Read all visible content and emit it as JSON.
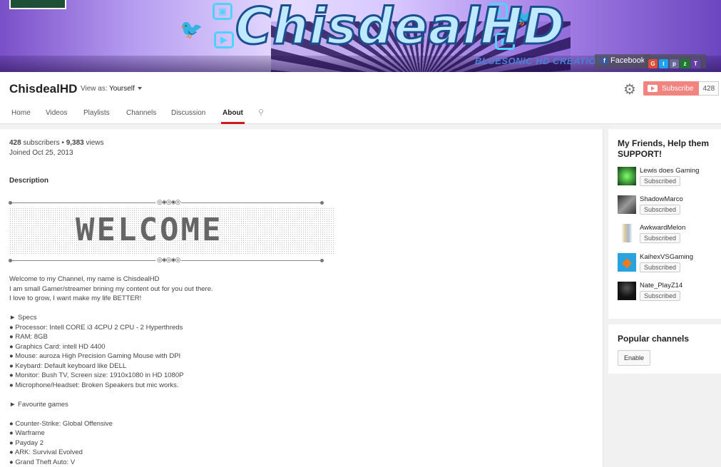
{
  "banner": {
    "title": "ChisdealHD",
    "credit": "BLUESONIC HD CREATIONS",
    "facebook_label": "Facebook",
    "social_icons": [
      "google-plus-icon",
      "twitter-icon",
      "periscope-icon",
      "green-icon",
      "twitch-icon"
    ]
  },
  "header": {
    "channel_name": "ChisdealHD",
    "view_as_label": "View as:",
    "view_as_value": "Yourself",
    "subscribe_label": "Subscribe",
    "subscriber_count": "428"
  },
  "tabs": [
    {
      "label": "Home"
    },
    {
      "label": "Videos"
    },
    {
      "label": "Playlists"
    },
    {
      "label": "Channels"
    },
    {
      "label": "Discussion"
    },
    {
      "label": "About",
      "active": true
    }
  ],
  "about": {
    "subscribers": "428",
    "subscribers_label": "subscribers",
    "separator": "•",
    "views": "9,383",
    "views_label": "views",
    "joined": "Joined Oct 25, 2013",
    "description_title": "Description",
    "welcome_art": "WELCOME",
    "lines": [
      "Welcome to my Channel, my name is ChisdealHD",
      "I am small Gamer/streamer brining my content out for you out there.",
      "I love to grow, I want make my life BETTER!",
      "",
      "► Specs",
      "● Processor: Intell CORE i3 4CPU 2 CPU - 2 Hyperthreds",
      "● RAM: 8GB",
      "● Graphics Card: intell HD 4400",
      "● Mouse: auroza High Precision Gaming Mouse with DPI",
      "● Keybard: Default keyboard like DELL",
      "● Monitor: Bush TV, Screen size: 1910x1080 in HD 1080P",
      "● Microphone/Headset: Broken Speakers but mic works.",
      "",
      "► Favourite games",
      "",
      "● Counter-Strike: Global Offensive",
      "● Warframe",
      "● Payday 2",
      "● ARK: Survival Evolved",
      "● Grand Theft Auto: V"
    ]
  },
  "friends": {
    "title": "My Friends, Help them SUPPORT!",
    "items": [
      {
        "name": "Lewis does Gaming",
        "button": "Subscribed",
        "color": "#1f7a3a"
      },
      {
        "name": "ShadowMarco",
        "button": "Subscribed",
        "color": "#5a5a5a"
      },
      {
        "name": "AwkwardMelon",
        "button": "Subscribed",
        "color": "#c9b78a"
      },
      {
        "name": "KaihexVSGaming",
        "button": "Subscribed",
        "color": "#f08a24"
      },
      {
        "name": "Nate_PlayZ14",
        "button": "Subscribed",
        "color": "#2a2a2a"
      }
    ]
  },
  "popular": {
    "title": "Popular channels",
    "button": "Enable"
  }
}
